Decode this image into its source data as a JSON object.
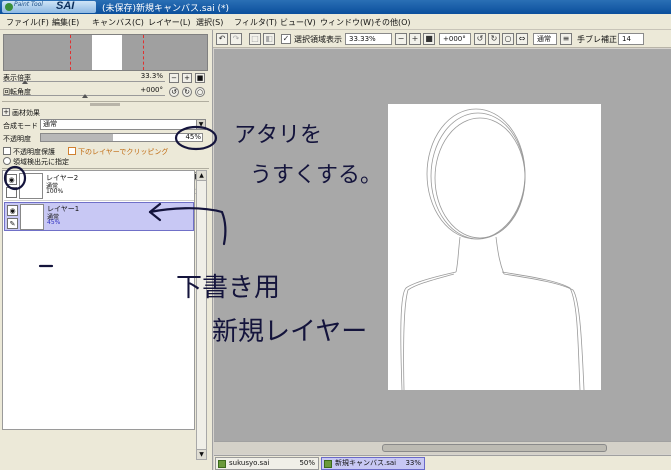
{
  "window": {
    "logo_small": "Paint Tool",
    "logo_big": "SAI",
    "title": "(未保存)新規キャンバス.sai (*)"
  },
  "menu": [
    "ファイル(F)",
    "編集(E)",
    "キャンバス(C)",
    "レイヤー(L)",
    "選択(S)",
    "フィルタ(T)",
    "ビュー(V)",
    "ウィンドウ(W)",
    "その他(O)"
  ],
  "navigator": {
    "zoom_label": "表示倍率",
    "zoom_value": "33.3%",
    "rotation_label": "回転角度",
    "rotation_value": "+000°"
  },
  "layer_panel": {
    "paper_effect": "画材効果",
    "blend_label": "合成モード",
    "blend_value": "通常",
    "opacity_label": "不透明度",
    "opacity_value": "45%",
    "opacity_fraction": 0.45,
    "preserve_opacity": "不透明度保護",
    "clip_below": "下のレイヤーでクリッピング",
    "selection_source": "領域検出元に指定"
  },
  "layers": [
    {
      "name": "レイヤー2",
      "mode": "通常",
      "opacity": "100%",
      "selected": false
    },
    {
      "name": "レイヤー1",
      "mode": "通常",
      "opacity": "45%",
      "selected": true
    }
  ],
  "canvas_toolbar": {
    "selection_display": "選択領域表示",
    "zoom": "33.33%",
    "rotation": "+000°",
    "blend": "通常",
    "stabilizer_label": "手ブレ補正",
    "stabilizer_value": "14"
  },
  "file_tabs": [
    {
      "name": "sukusyo.sai",
      "zoom": "50%",
      "active": false
    },
    {
      "name": "新規キャンバス.sai",
      "zoom": "33%",
      "active": true
    }
  ],
  "annotations": {
    "note_opacity_line1": "アタリを",
    "note_opacity_line2": "うすくする。",
    "note_layer_line1": "下書き用",
    "note_layer_line2": "新規レイヤー"
  },
  "colors": {
    "title_bar": "#0b4f9c",
    "selected_layer": "#c8c8f4",
    "canvas_bg": "#a8a8a8",
    "handwriting": "#14143c"
  }
}
